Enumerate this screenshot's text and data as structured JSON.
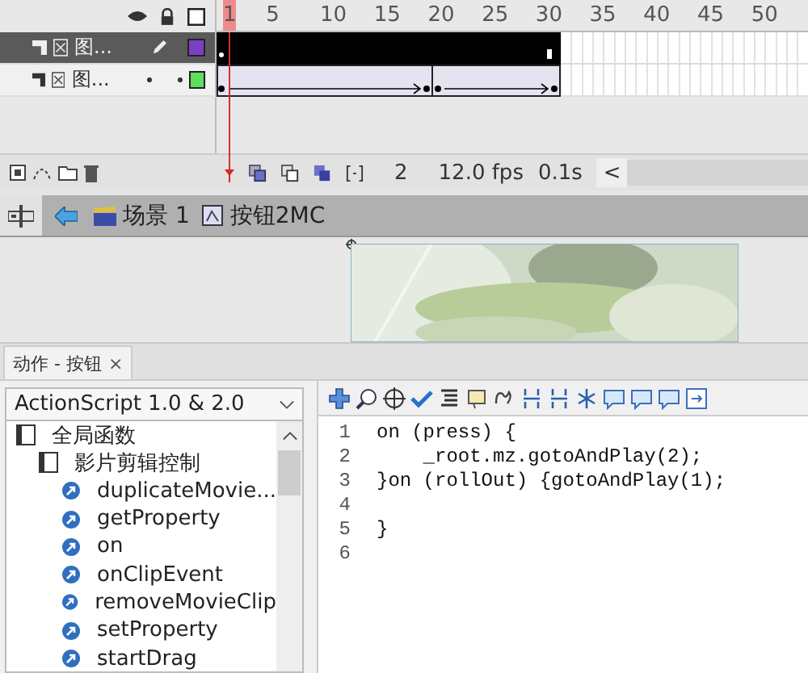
{
  "timeline": {
    "frame_numbers": [
      "1",
      "5",
      "10",
      "15",
      "20",
      "25",
      "30",
      "35",
      "40",
      "45",
      "50"
    ],
    "layers": [
      {
        "name": "图...",
        "selected": true,
        "color": "#7b3fc4",
        "kind": "shape"
      },
      {
        "name": "图...",
        "selected": false,
        "color": "#5ee05e",
        "kind": "tween"
      }
    ],
    "status": {
      "frame": "2",
      "fps": "12.0 fps",
      "time": "0.1s",
      "scroll": "<"
    }
  },
  "breadcrumb": [
    {
      "label": "场景 1",
      "kind": "scene"
    },
    {
      "label": "按钮2MC",
      "kind": "symbol"
    }
  ],
  "panel": {
    "tab": "动作 - 按钮",
    "close": "×",
    "language": "ActionScript 1.0 & 2.0",
    "tree": [
      {
        "label": "全局函数",
        "kind": "book",
        "children": [
          {
            "label": "影片剪辑控制",
            "kind": "book",
            "children": [
              {
                "label": "duplicateMovie...",
                "kind": "action"
              },
              {
                "label": "getProperty",
                "kind": "action"
              },
              {
                "label": "on",
                "kind": "action"
              },
              {
                "label": "onClipEvent",
                "kind": "action"
              },
              {
                "label": "removeMovieClip",
                "kind": "action"
              },
              {
                "label": "setProperty",
                "kind": "action"
              },
              {
                "label": "startDrag",
                "kind": "action"
              }
            ]
          }
        ]
      }
    ],
    "code": [
      {
        "number": "1",
        "text": "on (press) {"
      },
      {
        "number": "2",
        "text": "    _root.mz.gotoAndPlay(2);"
      },
      {
        "number": "3",
        "text": "}on (rollOut) {gotoAndPlay(1);"
      },
      {
        "number": "4"
      },
      {
        "number": "5",
        "text": "}"
      },
      {
        "number": "6"
      }
    ]
  }
}
